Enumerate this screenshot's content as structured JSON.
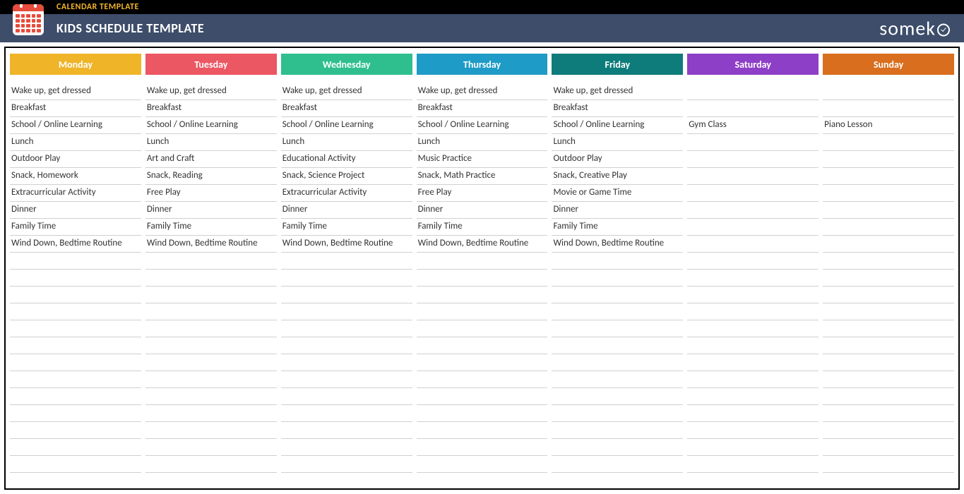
{
  "header": {
    "category": "CALENDAR TEMPLATE",
    "title": "KIDS SCHEDULE TEMPLATE",
    "brand": "someka"
  },
  "rowCount": 23,
  "days": [
    {
      "name": "Monday",
      "color": "#f0b429",
      "items": [
        "Wake up, get dressed",
        "Breakfast",
        "School / Online Learning",
        "Lunch",
        "Outdoor Play",
        "Snack, Homework",
        "Extracurricular Activity",
        "Dinner",
        "Family Time",
        "Wind Down, Bedtime Routine"
      ]
    },
    {
      "name": "Tuesday",
      "color": "#eb5763",
      "items": [
        "Wake up, get dressed",
        "Breakfast",
        "School / Online Learning",
        "Lunch",
        "Art and Craft",
        "Snack, Reading",
        "Free Play",
        "Dinner",
        "Family Time",
        "Wind Down, Bedtime Routine"
      ]
    },
    {
      "name": "Wednesday",
      "color": "#2fbf8f",
      "items": [
        "Wake up, get dressed",
        "Breakfast",
        "School / Online Learning",
        "Lunch",
        "Educational Activity",
        "Snack, Science Project",
        "Extracurricular Activity",
        "Dinner",
        "Family Time",
        "Wind Down, Bedtime Routine"
      ]
    },
    {
      "name": "Thursday",
      "color": "#1e9bc6",
      "items": [
        "Wake up, get dressed",
        "Breakfast",
        "School / Online Learning",
        "Lunch",
        "Music Practice",
        "Snack, Math Practice",
        "Free Play",
        "Dinner",
        "Family Time",
        "Wind Down, Bedtime Routine"
      ]
    },
    {
      "name": "Friday",
      "color": "#0e7c7b",
      "items": [
        "Wake up, get dressed",
        "Breakfast",
        "School / Online Learning",
        "Lunch",
        "Outdoor Play",
        "Snack, Creative Play",
        "Movie or Game Time",
        "Dinner",
        "Family Time",
        "Wind Down, Bedtime Routine"
      ]
    },
    {
      "name": "Saturday",
      "color": "#8e3fc7",
      "items": [
        "",
        "",
        "Gym Class"
      ]
    },
    {
      "name": "Sunday",
      "color": "#d96e1e",
      "items": [
        "",
        "",
        "Piano Lesson"
      ]
    }
  ]
}
